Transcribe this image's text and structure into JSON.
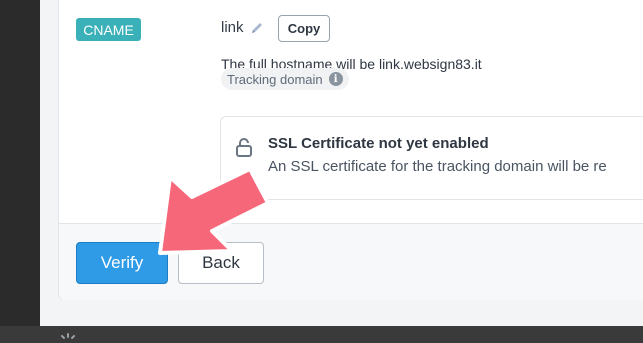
{
  "record": {
    "type_badge": "CNAME",
    "host_label": "link",
    "copy_label": "Copy",
    "full_hostname_text": "The full hostname will be link.websign83.it",
    "tracking_domain_label": "Tracking domain"
  },
  "ssl": {
    "title": "SSL Certificate not yet enabled",
    "description": "An SSL certificate for the tracking domain will be re"
  },
  "footer": {
    "verify_label": "Verify",
    "back_label": "Back"
  },
  "icons": [
    "pencil-icon",
    "info-icon",
    "lock-icon",
    "annotation-arrow",
    "loading-spinner-icon"
  ],
  "colors": {
    "badge": "#3ab0b8",
    "primary_button": "#2f9ae6",
    "annotation_arrow": "#f6677a"
  }
}
